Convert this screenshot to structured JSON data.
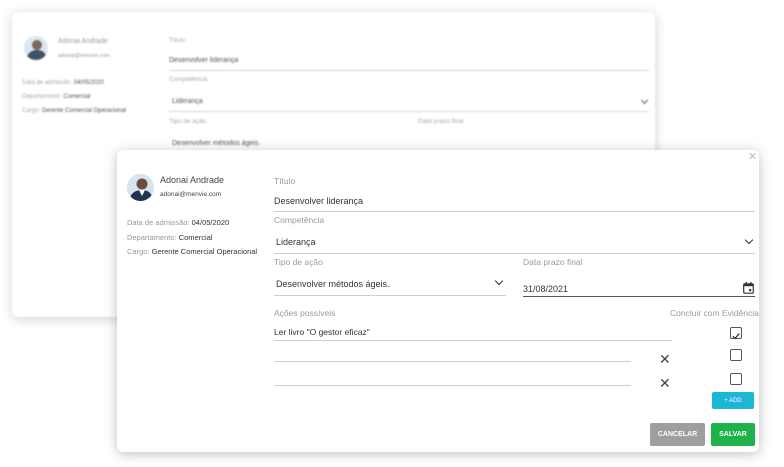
{
  "user": {
    "name": "Adonai Andrade",
    "email": "adonai@menvie.com",
    "admission_label": "Data de admissão:",
    "admission_value": "04/05/2020",
    "department_label": "Departamento:",
    "department_value": "Comercial",
    "role_label": "Cargo:",
    "role_value": "Gerente Comercial Operacional"
  },
  "form": {
    "title_label": "Título",
    "title_value": "Desenvolver liderança",
    "competence_label": "Competência",
    "competence_value": "Liderança",
    "action_type_label": "Tipo de ação",
    "action_type_value": "Desenvolver métodos ágeis.",
    "deadline_label": "Data prazo final",
    "deadline_value": "31/08/2021",
    "actions_label": "Ações possíveis",
    "conclude_label": "Concluir com Evidência",
    "actions": [
      {
        "text": "Ler livro \"O gestor eficaz\"",
        "checked": true
      },
      {
        "text": "",
        "checked": false
      },
      {
        "text": "",
        "checked": false
      }
    ]
  },
  "buttons": {
    "add": "+ ADD",
    "cancel": "CANCELAR",
    "save": "SALVAR"
  },
  "colors": {
    "add": "#1cb7d4",
    "cancel": "#9e9e9e",
    "save": "#1db24a"
  }
}
